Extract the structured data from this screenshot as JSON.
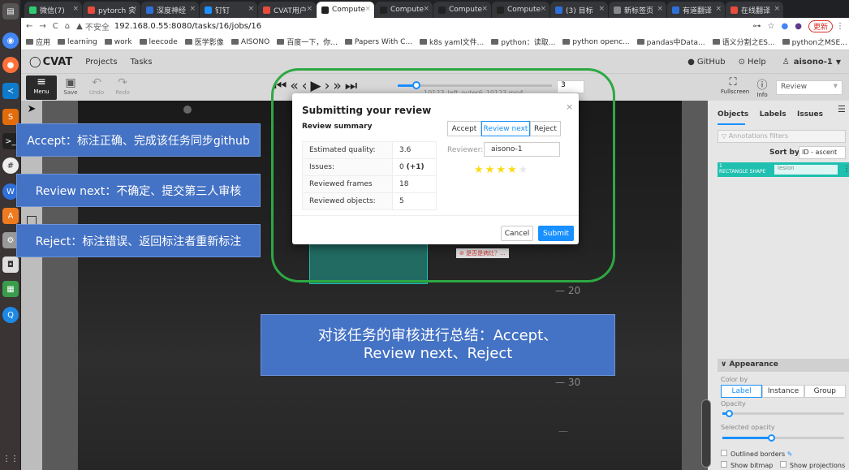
{
  "tabs": [
    {
      "label": "微信(7)",
      "color": "#2ecc71"
    },
    {
      "label": "pytorch 实",
      "color": "#e74c3c"
    },
    {
      "label": "深度神经",
      "color": "#2f6fd8"
    },
    {
      "label": "钉钉",
      "color": "#1e90ff"
    },
    {
      "label": "CVAT用户",
      "color": "#e74c3c"
    },
    {
      "label": "Compute",
      "color": "#222222"
    },
    {
      "label": "Compute",
      "color": "#222222"
    },
    {
      "label": "Compute",
      "color": "#222222"
    },
    {
      "label": "Compute",
      "color": "#222222"
    },
    {
      "label": "(3) 目标",
      "color": "#2f6fd8"
    },
    {
      "label": "新标签页",
      "color": "#888888"
    },
    {
      "label": "有道翻译",
      "color": "#2f6fd8"
    },
    {
      "label": "在线翻译",
      "color": "#e74c3c"
    }
  ],
  "omnibar": {
    "security": "不安全",
    "url": "192.168.0.55:8080/tasks/16/jobs/16",
    "update": "更新"
  },
  "bookmarks": [
    "应用",
    "learning",
    "work",
    "leecode",
    "医学影像",
    "AISONO",
    "百度一下，你...",
    "Papers With C...",
    "k8s yaml文件...",
    "python：读取...",
    "python openc...",
    "pandas中Data...",
    "语义分割之ES...",
    "python之MSE..."
  ],
  "cvat": {
    "logo": "CVAT",
    "projects": "Projects",
    "tasks": "Tasks",
    "github": "GitHub",
    "help": "Help",
    "user": "aisono-1",
    "toolbar": {
      "menu": "Menu",
      "save": "Save",
      "undo": "Undo",
      "redo": "Redo",
      "frame": "3",
      "filename": "10123_left_outer6_10123.mp4 ...",
      "fullscreen": "Fullscreen",
      "info": "Info",
      "mode": "Review"
    }
  },
  "sidepanel": {
    "tabs": [
      "Objects",
      "Labels",
      "Issues"
    ],
    "filter_placeholder": "Annotations filters",
    "sort_label": "Sort by",
    "sort_value": "ID - ascent",
    "object_id": "1",
    "object_type": "RECTANGLE SHAPE",
    "object_label": "lesion",
    "appearance": "Appearance",
    "color_by": "Color by",
    "color_options": [
      "Label",
      "Instance",
      "Group"
    ],
    "opacity": "Opacity",
    "opacity_value": 0.05,
    "selected_opacity": "Selected opacity",
    "selected_opacity_value": 0.4,
    "outlined": "Outlined borders",
    "show_bitmap": "Show bitmap",
    "show_projections": "Show projections"
  },
  "modal": {
    "title": "Submitting your review",
    "summary": "Review summary",
    "rows": [
      {
        "k": "Estimated quality:",
        "v": "3.6"
      },
      {
        "k": "Issues:",
        "v": "0 ",
        "extra": "(+1)"
      },
      {
        "k": "Reviewed frames",
        "v": "18"
      },
      {
        "k": "Reviewed objects:",
        "v": "5"
      }
    ],
    "options": [
      "Accept",
      "Review next",
      "Reject"
    ],
    "reviewer_label": "Reviewer:",
    "reviewer": "aisono-1",
    "stars": 4,
    "stars_max": 5,
    "cancel": "Cancel",
    "submit": "Submit"
  },
  "annotations": {
    "accept": "Accept：标注正确、完成该任务同步github",
    "review_next": "Review next：不确定、提交第三人审核",
    "reject": "Reject：标注错误、返回标注者重新标注",
    "summary_line1": "对该任务的审核进行总结：Accept、",
    "summary_line2": "Review next、Reject"
  },
  "canvas": {
    "issue_tag": "是否是病灶？...",
    "ticks": [
      "20",
      "30"
    ]
  },
  "colors": {
    "accent": "#1890ff",
    "annotation_blue": "#4472c4",
    "highlight_green": "#2ea843",
    "object_teal": "#20c0b0"
  }
}
